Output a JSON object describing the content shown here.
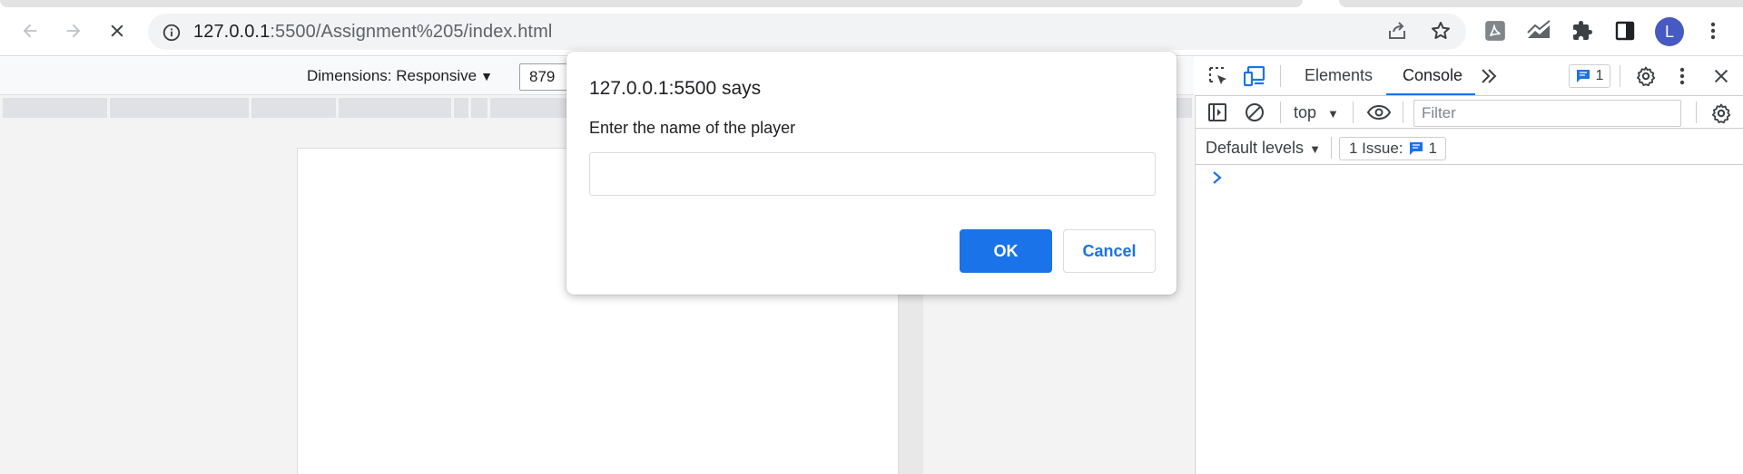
{
  "browser": {
    "url_host": "127.0.0.1",
    "url_rest": ":5500/Assignment%205/index.html",
    "avatar_letter": "L",
    "accent": "#1a73e8"
  },
  "device_toolbar": {
    "dimensions_label": "Dimensions: Responsive",
    "width_value": "879"
  },
  "devtools": {
    "tabs": [
      "Elements",
      "Console"
    ],
    "active_tab": "Console",
    "issue_count_top": "1",
    "context": "top",
    "filter_placeholder": "Filter",
    "levels_label": "Default levels",
    "issues_label": "1 Issue:",
    "issues_count": "1"
  },
  "dialog": {
    "title": "127.0.0.1:5500 says",
    "message": "Enter the name of the player",
    "input_value": "",
    "ok_label": "OK",
    "cancel_label": "Cancel"
  },
  "icons": [
    "back-arrow-icon",
    "forward-arrow-icon",
    "close-icon",
    "info-icon",
    "share-icon",
    "star-icon",
    "pdf-extension-icon",
    "analytics-extension-icon",
    "puzzle-icon",
    "side-panel-icon",
    "kebab-menu-icon",
    "inspect-element-icon",
    "device-toggle-icon",
    "chevron-double-right-icon",
    "message-icon",
    "gear-icon",
    "sidebar-toggle-icon",
    "clear-console-icon",
    "eye-icon"
  ]
}
